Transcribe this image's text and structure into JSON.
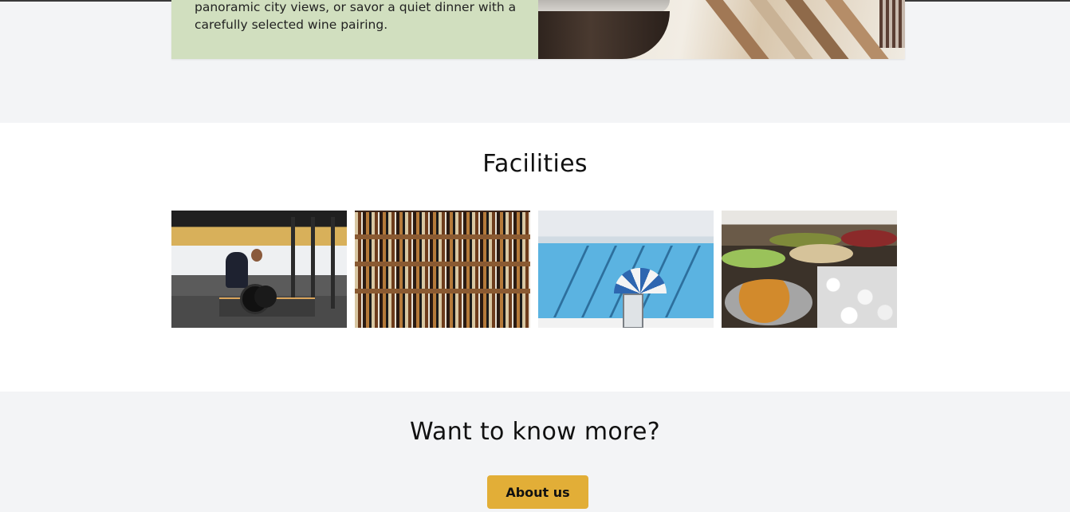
{
  "restaurant": {
    "description": "panoramic city views, or savor a quiet dinner with a carefully selected wine pairing."
  },
  "facilities": {
    "title": "Facilities",
    "photos": [
      "gym-photo",
      "bar-photo",
      "pool-photo",
      "buffet-photo"
    ]
  },
  "cta": {
    "title": "Want to know more?",
    "button_label": "About us",
    "button_color": "#e2ae37"
  },
  "colors": {
    "page_bg": "#f3f4f6",
    "card_bg": "#d1dfbf",
    "section_bg": "#ffffff"
  }
}
